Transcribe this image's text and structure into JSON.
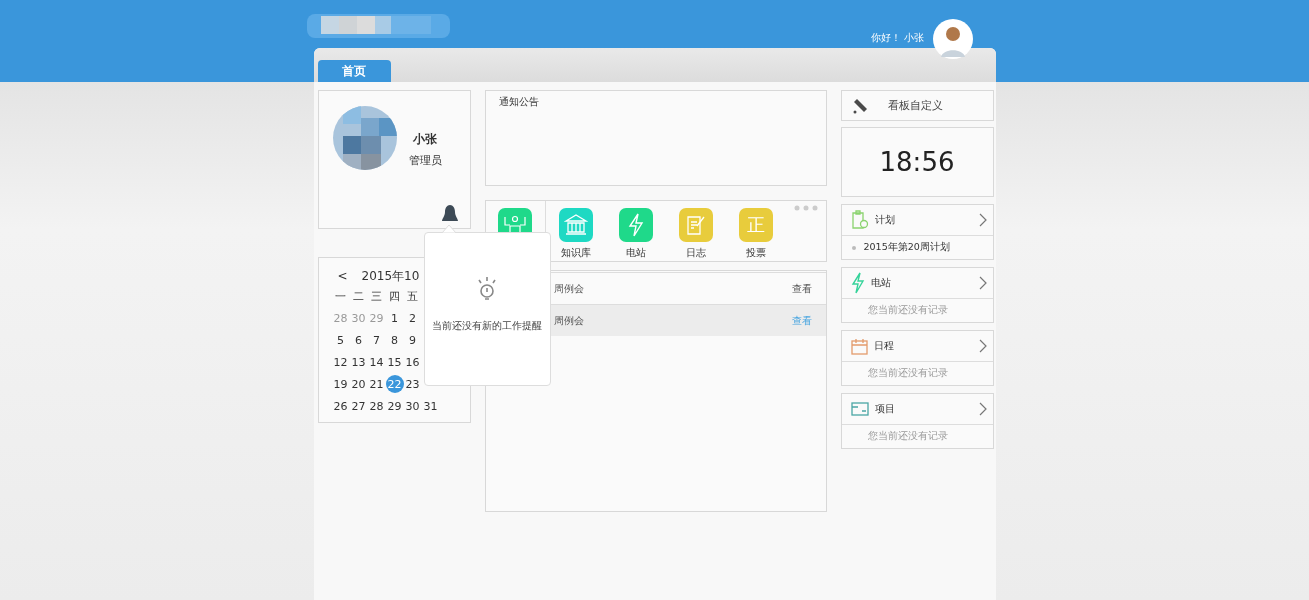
{
  "header": {
    "greeting": "你好！ 小张"
  },
  "tabs": [
    {
      "label": "首页",
      "selected": true
    }
  ],
  "profile": {
    "name": "小张",
    "role": "管理员"
  },
  "reminder_popup": {
    "message": "当前还没有新的工作提醒"
  },
  "calendar": {
    "prev": "<",
    "month": "2015年10",
    "weekdays": [
      "一",
      "二",
      "三",
      "四",
      "五"
    ],
    "weeks": [
      [
        {
          "day": "28",
          "other_month": true,
          "selected": false
        },
        {
          "day": "30",
          "other_month": true,
          "selected": false
        },
        {
          "day": "29",
          "other_month": true,
          "selected": false
        },
        {
          "day": "1",
          "other_month": false,
          "selected": false
        },
        {
          "day": "2",
          "other_month": false,
          "selected": false
        }
      ],
      [
        {
          "day": "5",
          "other_month": false,
          "selected": false
        },
        {
          "day": "6",
          "other_month": false,
          "selected": false
        },
        {
          "day": "7",
          "other_month": false,
          "selected": false
        },
        {
          "day": "8",
          "other_month": false,
          "selected": false
        },
        {
          "day": "9",
          "other_month": false,
          "selected": false
        }
      ],
      [
        {
          "day": "12",
          "other_month": false,
          "selected": false
        },
        {
          "day": "13",
          "other_month": false,
          "selected": false
        },
        {
          "day": "14",
          "other_month": false,
          "selected": false
        },
        {
          "day": "15",
          "other_month": false,
          "selected": false
        },
        {
          "day": "16",
          "other_month": false,
          "selected": false
        }
      ],
      [
        {
          "day": "19",
          "other_month": false,
          "selected": false
        },
        {
          "day": "20",
          "other_month": false,
          "selected": false
        },
        {
          "day": "21",
          "other_month": false,
          "selected": false
        },
        {
          "day": "22",
          "other_month": false,
          "selected": true
        },
        {
          "day": "23",
          "other_month": false,
          "selected": false
        }
      ],
      [
        {
          "day": "26",
          "other_month": false,
          "selected": false
        },
        {
          "day": "27",
          "other_month": false,
          "selected": false
        },
        {
          "day": "28",
          "other_month": false,
          "selected": false
        },
        {
          "day": "29",
          "other_month": false,
          "selected": false
        },
        {
          "day": "30",
          "other_month": false,
          "selected": false
        },
        {
          "day": "31",
          "other_month": false,
          "selected": false
        }
      ]
    ]
  },
  "notice": {
    "title": "通知公告"
  },
  "apps": [
    {
      "kind": "meeting",
      "color": "#1fd98a"
    },
    {
      "kind": "knowledge",
      "label": "知识库",
      "color": "#1ed9c3"
    },
    {
      "kind": "power",
      "label": "电站",
      "color": "#1fd98a"
    },
    {
      "kind": "log",
      "label": "日志",
      "color": "#e8cc3c"
    },
    {
      "kind": "vote",
      "label": "投票",
      "color": "#e8cc3c",
      "glyph": "正"
    }
  ],
  "list": [
    {
      "title": "周例会",
      "action": "查看",
      "selected": false
    },
    {
      "title": "周例会",
      "action": "查看",
      "selected": true
    }
  ],
  "customize": {
    "label": "看板自定义"
  },
  "clock": {
    "time": "18:56"
  },
  "widgets": [
    {
      "kind": "plan",
      "title": "计划",
      "items": [
        "2015年第20周计划"
      ]
    },
    {
      "kind": "power",
      "title": "电站",
      "empty": "您当前还没有记录"
    },
    {
      "kind": "schedule",
      "title": "日程",
      "empty": "您当前还没有记录"
    },
    {
      "kind": "project",
      "title": "项目",
      "empty": "您当前还没有记录"
    }
  ]
}
